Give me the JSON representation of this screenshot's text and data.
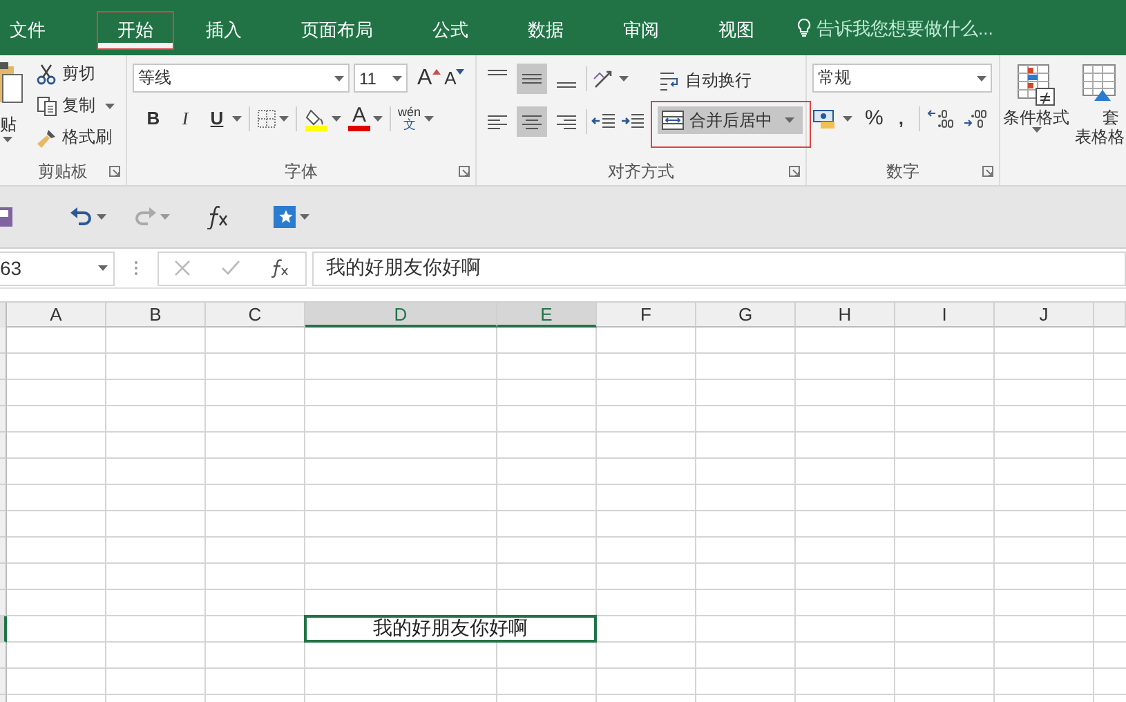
{
  "tabs": [
    {
      "label": "文件",
      "selected": false
    },
    {
      "label": "开始",
      "selected": true
    },
    {
      "label": "插入",
      "selected": false
    },
    {
      "label": "页面布局",
      "selected": false
    },
    {
      "label": "公式",
      "selected": false
    },
    {
      "label": "数据",
      "selected": false
    },
    {
      "label": "审阅",
      "selected": false
    },
    {
      "label": "视图",
      "selected": false
    }
  ],
  "tell_me": {
    "placeholder": "告诉我您想要做什么..."
  },
  "clipboard": {
    "paste_label": "贴",
    "items": [
      "剪切",
      "复制",
      "格式刷"
    ],
    "label": "剪贴板"
  },
  "font": {
    "name": "等线",
    "size": "11",
    "grow": "A",
    "shrink": "A",
    "styles": [
      "B",
      "I",
      "U"
    ],
    "color_letter": "A",
    "phonetic_top": "wén",
    "phonetic_bottom": "文",
    "label": "字体"
  },
  "alignment": {
    "vertical": [
      {
        "selected": false
      },
      {
        "selected": true
      },
      {
        "selected": false
      }
    ],
    "horizontal": [
      {
        "selected": false
      },
      {
        "selected": true
      },
      {
        "selected": false
      }
    ],
    "wrap": "自动换行",
    "merge": {
      "label": "合并后居中",
      "highlighted": true
    },
    "label": "对齐方式"
  },
  "number": {
    "format": "常规",
    "percent": "%",
    "comma": ",",
    "label": "数字"
  },
  "styles": {
    "conditional": "条件格式",
    "table_line1": "套",
    "table_line2": "表格格"
  },
  "name_box": {
    "value": "63"
  },
  "formula_bar": {
    "value": "我的好朋友你好啊"
  },
  "columns": [
    {
      "label": "A",
      "selected": false
    },
    {
      "label": "B",
      "selected": false
    },
    {
      "label": "C",
      "selected": false
    },
    {
      "label": "D",
      "selected": true
    },
    {
      "label": "E",
      "selected": true
    },
    {
      "label": "F",
      "selected": false
    },
    {
      "label": "G",
      "selected": false
    },
    {
      "label": "H",
      "selected": false
    },
    {
      "label": "I",
      "selected": false
    },
    {
      "label": "J",
      "selected": false
    }
  ],
  "active_cell": {
    "text": "我的好朋友你好啊"
  }
}
